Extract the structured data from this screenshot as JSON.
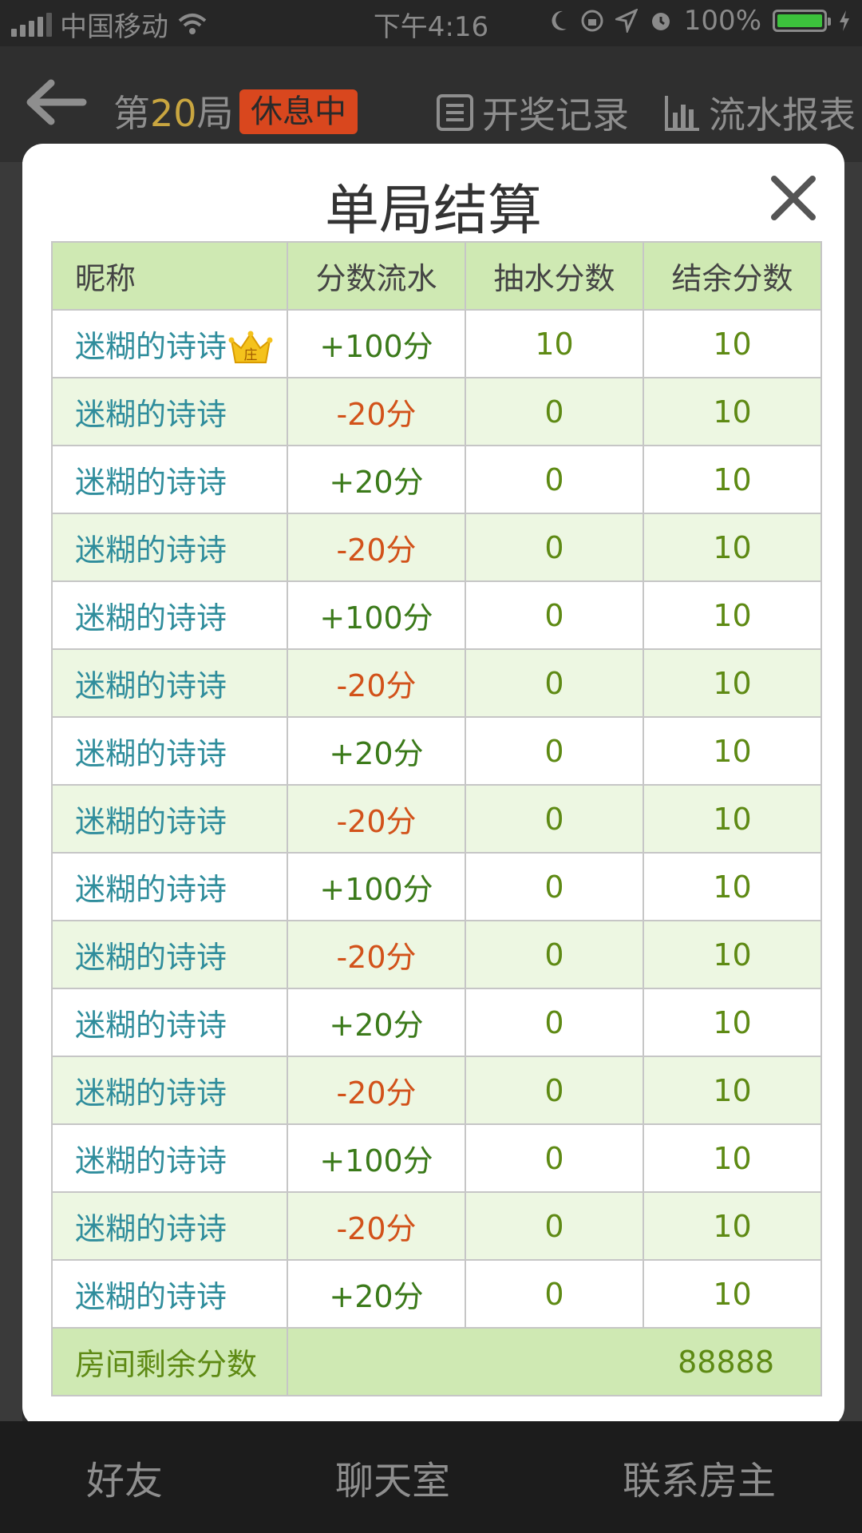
{
  "status_bar": {
    "carrier": "中国移动",
    "time": "下午4:16",
    "battery": "100%"
  },
  "header": {
    "round_prefix": "第",
    "round_number": "20",
    "round_suffix": "局",
    "status_badge": "休息中",
    "history_label": "开奖记录",
    "report_label": "流水报表"
  },
  "modal": {
    "title": "单局结算",
    "columns": [
      "昵称",
      "分数流水",
      "抽水分数",
      "结余分数"
    ],
    "rows": [
      {
        "nickname": "迷糊的诗诗",
        "flow": "+100分",
        "fee": "10",
        "balance": "10",
        "dealer": true
      },
      {
        "nickname": "迷糊的诗诗",
        "flow": "-20分",
        "fee": "0",
        "balance": "10"
      },
      {
        "nickname": "迷糊的诗诗",
        "flow": "+20分",
        "fee": "0",
        "balance": "10"
      },
      {
        "nickname": "迷糊的诗诗",
        "flow": "-20分",
        "fee": "0",
        "balance": "10"
      },
      {
        "nickname": "迷糊的诗诗",
        "flow": "+100分",
        "fee": "0",
        "balance": "10"
      },
      {
        "nickname": "迷糊的诗诗",
        "flow": "-20分",
        "fee": "0",
        "balance": "10"
      },
      {
        "nickname": "迷糊的诗诗",
        "flow": "+20分",
        "fee": "0",
        "balance": "10"
      },
      {
        "nickname": "迷糊的诗诗",
        "flow": "-20分",
        "fee": "0",
        "balance": "10"
      },
      {
        "nickname": "迷糊的诗诗",
        "flow": "+100分",
        "fee": "0",
        "balance": "10"
      },
      {
        "nickname": "迷糊的诗诗",
        "flow": "-20分",
        "fee": "0",
        "balance": "10"
      },
      {
        "nickname": "迷糊的诗诗",
        "flow": "+20分",
        "fee": "0",
        "balance": "10"
      },
      {
        "nickname": "迷糊的诗诗",
        "flow": "-20分",
        "fee": "0",
        "balance": "10"
      },
      {
        "nickname": "迷糊的诗诗",
        "flow": "+100分",
        "fee": "0",
        "balance": "10"
      },
      {
        "nickname": "迷糊的诗诗",
        "flow": "-20分",
        "fee": "0",
        "balance": "10"
      },
      {
        "nickname": "迷糊的诗诗",
        "flow": "+20分",
        "fee": "0",
        "balance": "10"
      }
    ],
    "total_label": "房间剩余分数",
    "total_value": "88888",
    "dealer_mark": "庄"
  },
  "bottom_bar": {
    "friends": "好友",
    "chat": "聊天室",
    "contact": "联系房主"
  },
  "colors": {
    "header_green": "#cfe9b3",
    "row_alt": "#edf7e2",
    "nick": "#2f8d9c",
    "positive": "#3b7a1a",
    "negative": "#d2521a",
    "badge": "#d9471e"
  }
}
